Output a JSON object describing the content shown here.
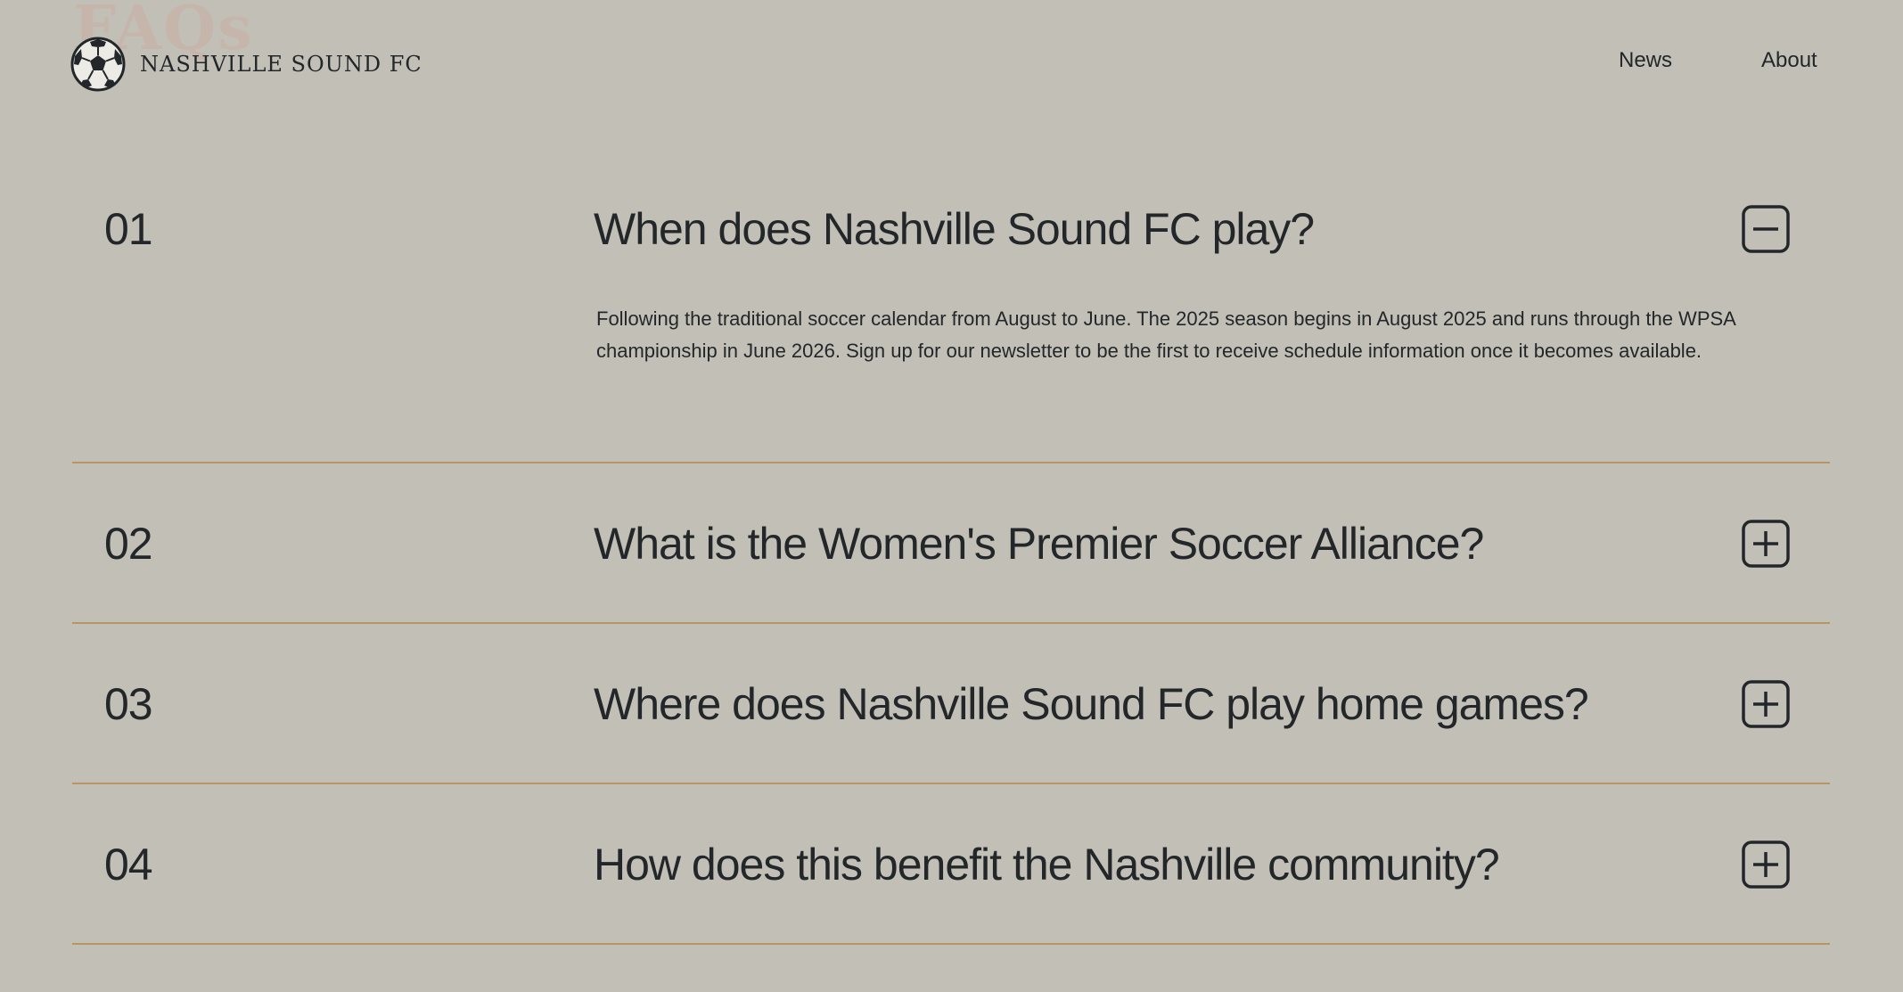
{
  "ghost_text": "FAQs",
  "header": {
    "logo_text": "NASHVILLE SOUND FC",
    "logo_icon": "soccer-ball-icon",
    "nav": [
      {
        "label": "News"
      },
      {
        "label": "About"
      }
    ]
  },
  "faq": {
    "items": [
      {
        "number": "01",
        "question": "When does Nashville Sound FC play?",
        "expanded": true,
        "toggle_icon": "minus-square-icon",
        "answer": "Following the traditional soccer calendar from August to June. The 2025 season begins in August 2025 and runs through the WPSA championship in June 2026. Sign up for our newsletter to be the first to receive schedule information once it becomes available."
      },
      {
        "number": "02",
        "question": "What is the Women's Premier Soccer Alliance?",
        "expanded": false,
        "toggle_icon": "plus-square-icon"
      },
      {
        "number": "03",
        "question": "Where does Nashville Sound FC play home games?",
        "expanded": false,
        "toggle_icon": "plus-square-icon"
      },
      {
        "number": "04",
        "question": "How does this benefit the Nashville community?",
        "expanded": false,
        "toggle_icon": "plus-square-icon"
      }
    ]
  },
  "colors": {
    "background": "#c2c0b6",
    "text": "#23272a",
    "divider": "#b79665"
  }
}
